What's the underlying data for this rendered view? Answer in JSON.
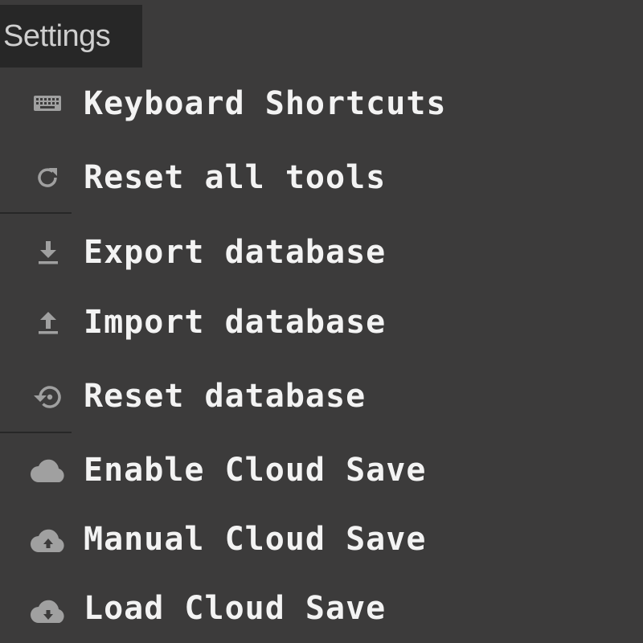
{
  "header": {
    "title": "Settings"
  },
  "menu": {
    "items": [
      {
        "label": "Keyboard Shortcuts",
        "icon": "keyboard-icon"
      },
      {
        "label": "Reset all tools",
        "icon": "refresh-icon"
      },
      {
        "label": "Export database",
        "icon": "download-icon"
      },
      {
        "label": "Import database",
        "icon": "upload-icon"
      },
      {
        "label": "Reset database",
        "icon": "restore-icon"
      },
      {
        "label": "Enable Cloud Save",
        "icon": "cloud-icon"
      },
      {
        "label": "Manual Cloud Save",
        "icon": "cloud-upload-icon"
      },
      {
        "label": "Load Cloud Save",
        "icon": "cloud-download-icon"
      }
    ]
  },
  "colors": {
    "background": "#3c3b3b",
    "header_bg": "#272727",
    "text": "#f3f3f3",
    "icon": "#a0a0a0"
  }
}
